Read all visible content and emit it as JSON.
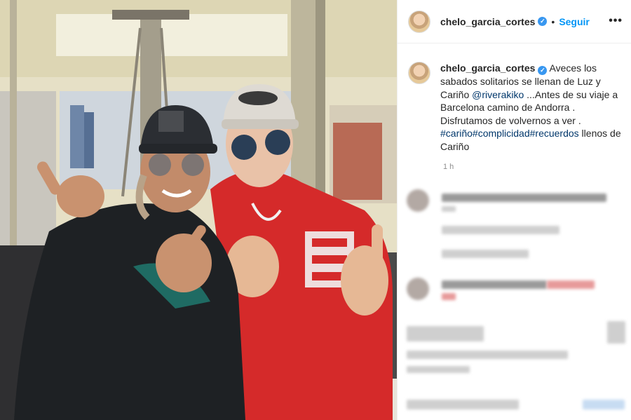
{
  "post": {
    "username": "chelo_garcia_cortes",
    "verified_mark": "✓",
    "separator": "•",
    "follow_label": "Seguir",
    "more_label": "•••"
  },
  "caption": {
    "username": "chelo_garcia_cortes",
    "text_1": " Aveces los sabados solitarios se llenan de Luz y Cariño ",
    "mention": "@riverakiko",
    "text_2": " ...Antes de su viaje a Barcelona camino de Andorra . Disfrutamos de volvernos a ver . ",
    "hashtags": "#cariño#complicidad#recuerdos",
    "text_3": " llenos de Cariño"
  },
  "timestamp": "1 h",
  "icons": [
    "verified-badge-icon",
    "more-options-icon",
    "profile-avatar-icon"
  ],
  "colors": {
    "follow_blue": "#0095f6",
    "link_dark_blue": "#00376b",
    "hoodie_red": "#d52a2a"
  }
}
